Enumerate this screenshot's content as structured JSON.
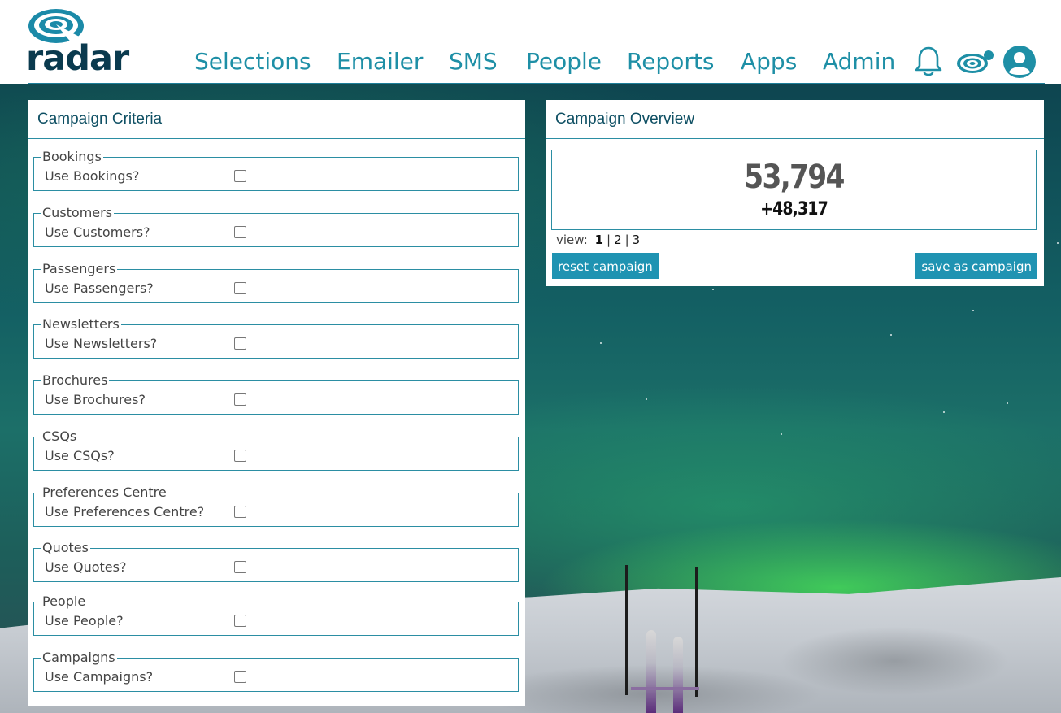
{
  "app": {
    "logo_text": "radar"
  },
  "nav": {
    "items": [
      {
        "label": "Selections"
      },
      {
        "label": "Emailer"
      },
      {
        "label": "SMS"
      },
      {
        "label": "People"
      },
      {
        "label": "Reports"
      },
      {
        "label": "Apps"
      },
      {
        "label": "Admin"
      }
    ],
    "icons": [
      "bell-icon",
      "radar-icon",
      "user-icon"
    ]
  },
  "colors": {
    "accent": "#1e8fa6",
    "button": "#1f93b2",
    "logo_dark": "#0a3a4e",
    "border": "#2b8ea3"
  },
  "criteria": {
    "title": "Campaign Criteria",
    "groups": [
      {
        "legend": "Bookings",
        "label": "Use Bookings?",
        "checked": false
      },
      {
        "legend": "Customers",
        "label": "Use Customers?",
        "checked": false
      },
      {
        "legend": "Passengers",
        "label": "Use Passengers?",
        "checked": false
      },
      {
        "legend": "Newsletters",
        "label": "Use Newsletters?",
        "checked": false
      },
      {
        "legend": "Brochures",
        "label": "Use Brochures?",
        "checked": false
      },
      {
        "legend": "CSQs",
        "label": "Use CSQs?",
        "checked": false
      },
      {
        "legend": "Preferences Centre",
        "label": "Use Preferences Centre?",
        "checked": false
      },
      {
        "legend": "Quotes",
        "label": "Use Quotes?",
        "checked": false
      },
      {
        "legend": "People",
        "label": "Use People?",
        "checked": false
      },
      {
        "legend": "Campaigns",
        "label": "Use Campaigns?",
        "checked": false
      }
    ]
  },
  "overview": {
    "title": "Campaign Overview",
    "count": "53,794",
    "delta": "+48,317",
    "view_label": "view:",
    "pages": [
      "1",
      "2",
      "3"
    ],
    "active_page": "1",
    "reset_label": "reset campaign",
    "save_label": "save as campaign"
  }
}
